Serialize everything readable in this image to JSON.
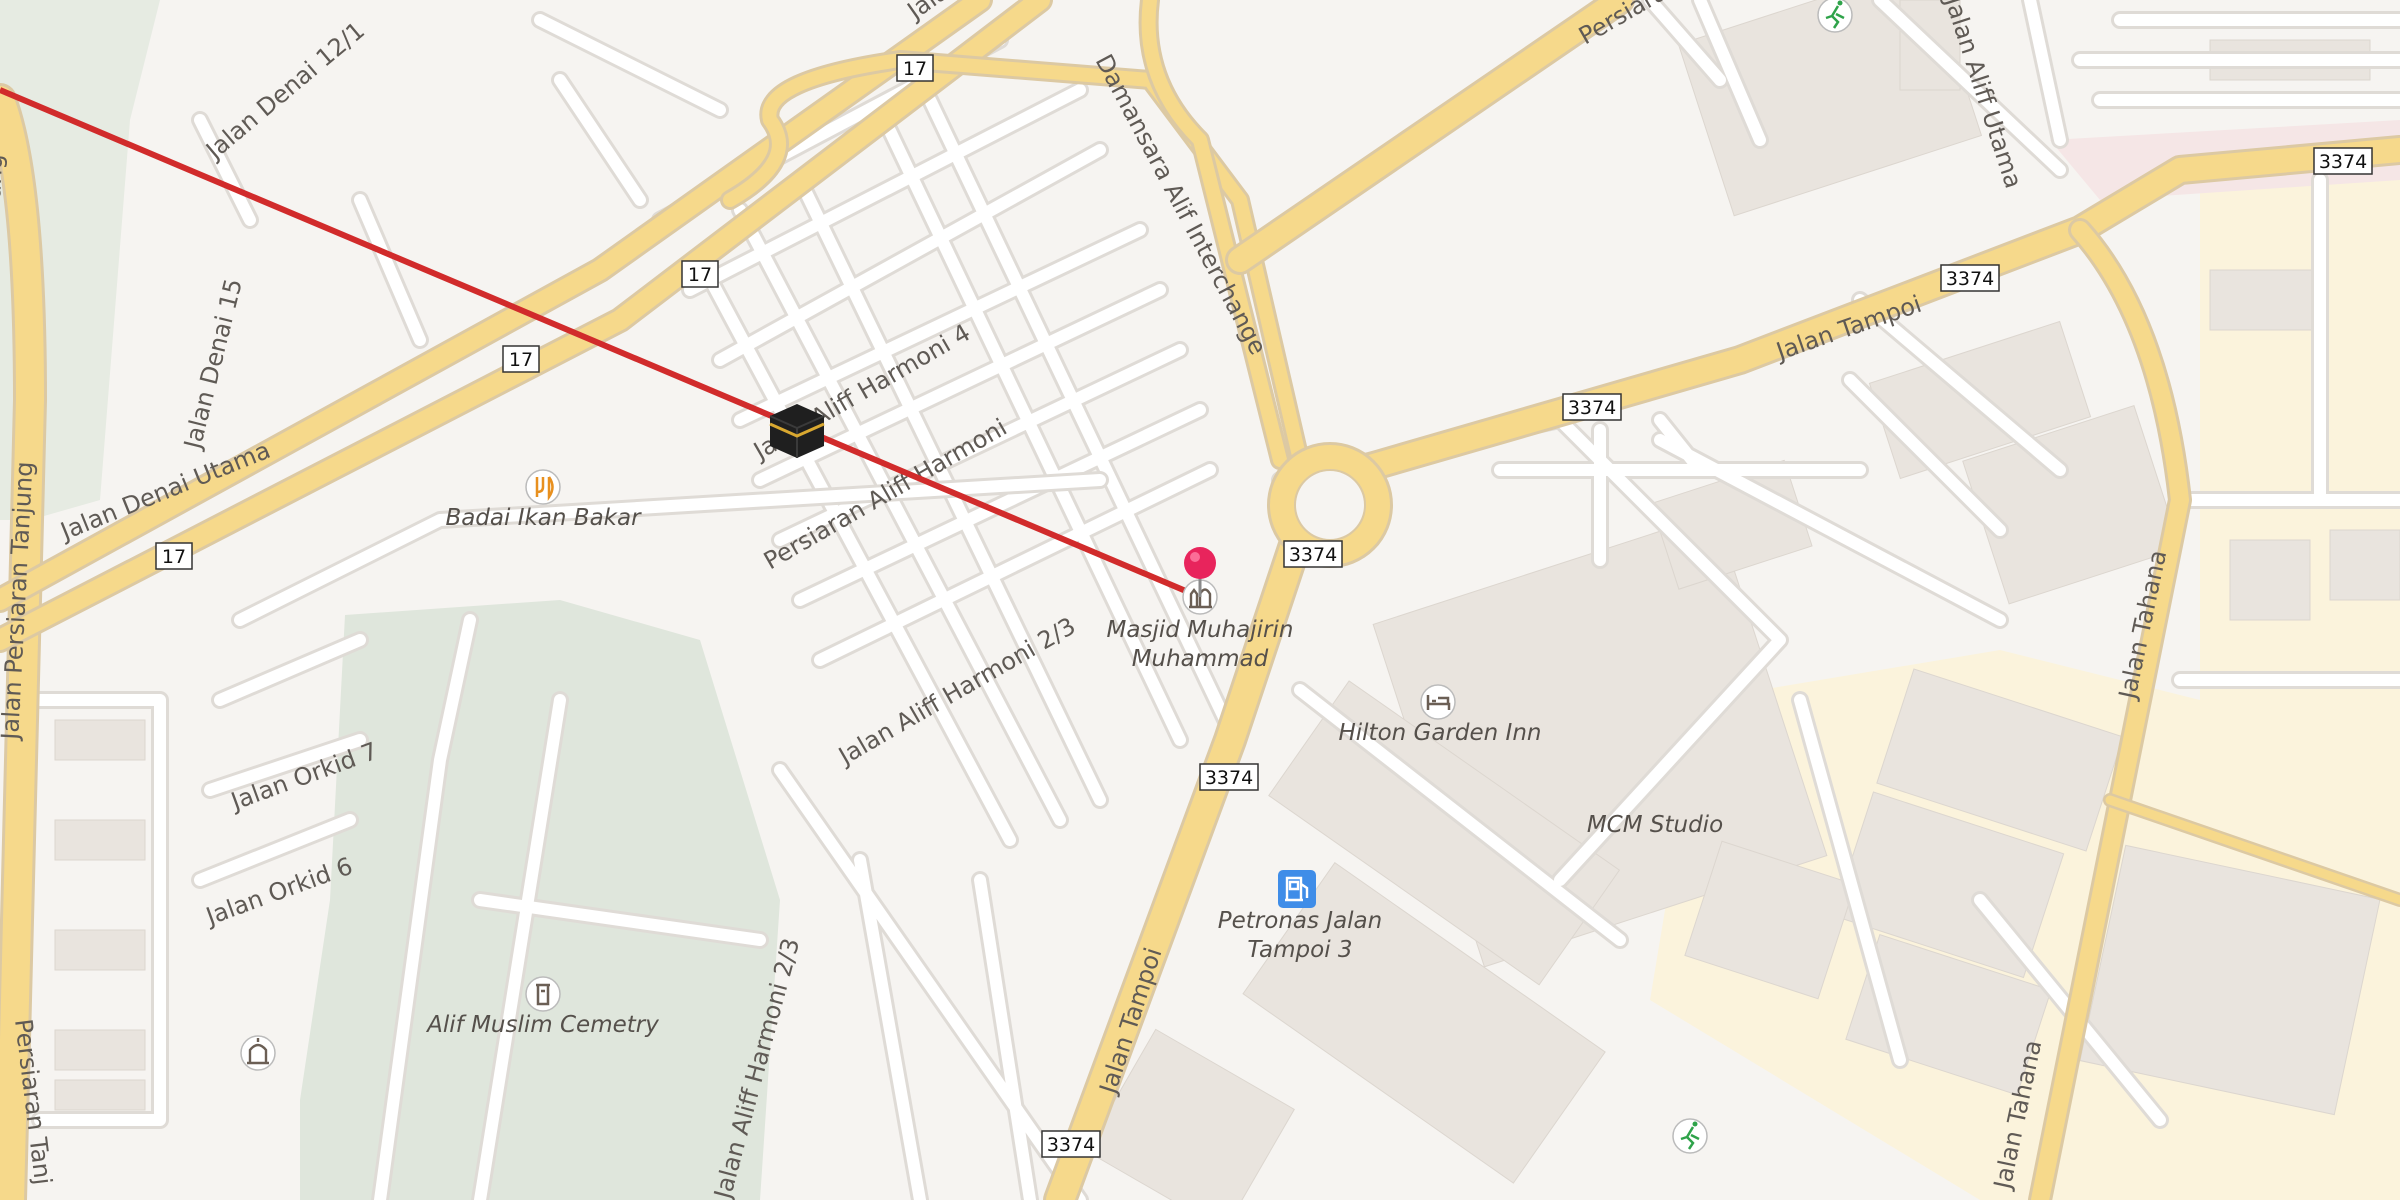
{
  "map": {
    "road_labels": {
      "jalan_denai_12_1": "Jalan Denai 12/1",
      "jalan_denai_15": "Jalan Denai 15",
      "jalan_denai_utama": "Jalan Denai Utama",
      "jalan_persiaran_tanjung": "Jalan Persiaran Tanjung",
      "jalan_aliff_harmoni_4": "Jalan Aliff Harmoni 4",
      "persiaran_aliff_harmoni": "Persiaran Aliff Harmoni",
      "jalan_aliff_harmoni_2_3_a": "Jalan Aliff Harmoni 2/3",
      "jalan_aliff_harmoni_2_3_b": "Jalan Aliff Harmoni 2/3",
      "jalan_orkid_7": "Jalan Orkid 7",
      "jalan_orkid_6": "Jalan Orkid 6",
      "damansara_alif_interchange": "Damansara Alif Interchange",
      "jalan_tampoi_1": "Jalan Tampoi",
      "jalan_tampoi_2": "Jalan Tampoi",
      "jalan_aliff_utama": "Jalan Aliff Utama",
      "jalan_tahana_1": "Jalan Tahana",
      "jalan_tahana_2": "Jalan Tahana",
      "persiaran_top": "Persiaran",
      "jalan_top": "Jalan",
      "persiaran_tanj_bottom": "Persiaran Tanj"
    },
    "shields": {
      "s17_a": "17",
      "s17_b": "17",
      "s17_c": "17",
      "s17_d": "17",
      "s3374_a": "3374",
      "s3374_b": "3374",
      "s3374_c": "3374",
      "s3374_d": "3374",
      "s3374_e": "3374",
      "s3374_f": "3374"
    },
    "pois": {
      "badai": "Badai Ikan Bakar",
      "masjid_line1": "Masjid Muhajirin",
      "masjid_line2": "Muhammad",
      "hilton": "Hilton Garden Inn",
      "mcm": "MCM Studio",
      "petronas_line1": "Petronas Jalan",
      "petronas_line2": "Tampoi 3",
      "cemetery": "Alif Muslim Cemetry"
    },
    "icons": {
      "restaurant": "fork-knife-icon",
      "mosque": "mosque-icon",
      "hotel": "bed-icon",
      "fuel": "fuel-pump-icon",
      "cemetery": "cemetery-icon",
      "kaaba": "kaaba-icon",
      "pin": "map-pin-icon",
      "sports": "running-person-icon"
    },
    "colors": {
      "background": "#f6f4f1",
      "major_road": "#f6d98b",
      "major_casing": "#dcc9a3",
      "qibla_line": "#d12b2b",
      "pin": "#e8245c",
      "green_area": "#dfe6dc",
      "yellow_zone": "#fbf3dc",
      "fuel_icon": "#3f8de8"
    }
  }
}
